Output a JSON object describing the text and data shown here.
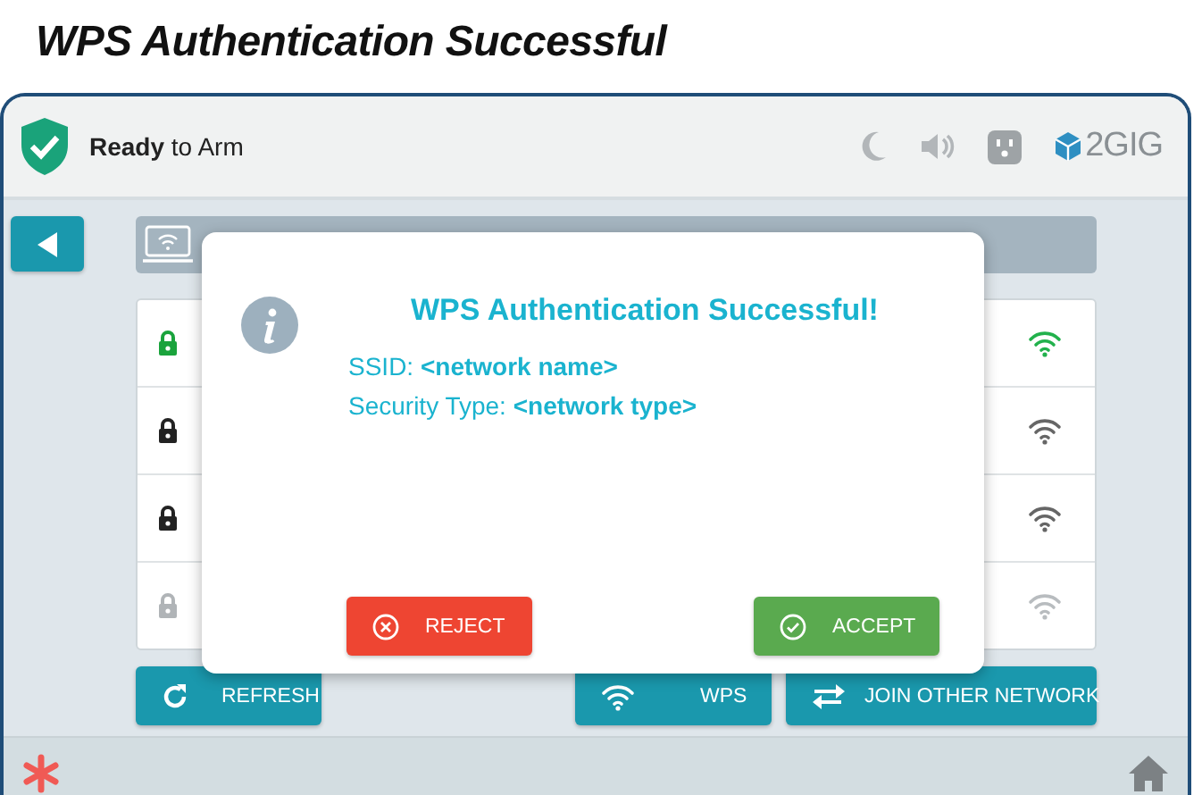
{
  "page_title": "WPS Authentication Successful",
  "status": {
    "text": "**Ready** to Arm"
  },
  "logo": {
    "text": "2GIG"
  },
  "network_list": {
    "rows": [
      {
        "connected": true,
        "disabled": false
      },
      {
        "connected": false,
        "disabled": false
      },
      {
        "connected": false,
        "disabled": false
      },
      {
        "connected": false,
        "disabled": true
      }
    ]
  },
  "dialog": {
    "title": "WPS Authentication Successful!",
    "lines": [
      "SSID: **<network name>**",
      "Security Type: **<network type>**"
    ],
    "buttons": [
      {
        "label": "REJECT",
        "kind": "reject"
      },
      {
        "label": "ACCEPT",
        "kind": "accept"
      }
    ]
  },
  "actions": [
    {
      "label": "REFRESH",
      "kind": "refresh"
    },
    {
      "label": "WPS",
      "kind": "wps"
    },
    {
      "label": "JOIN OTHER NETWORK",
      "kind": "join"
    }
  ]
}
